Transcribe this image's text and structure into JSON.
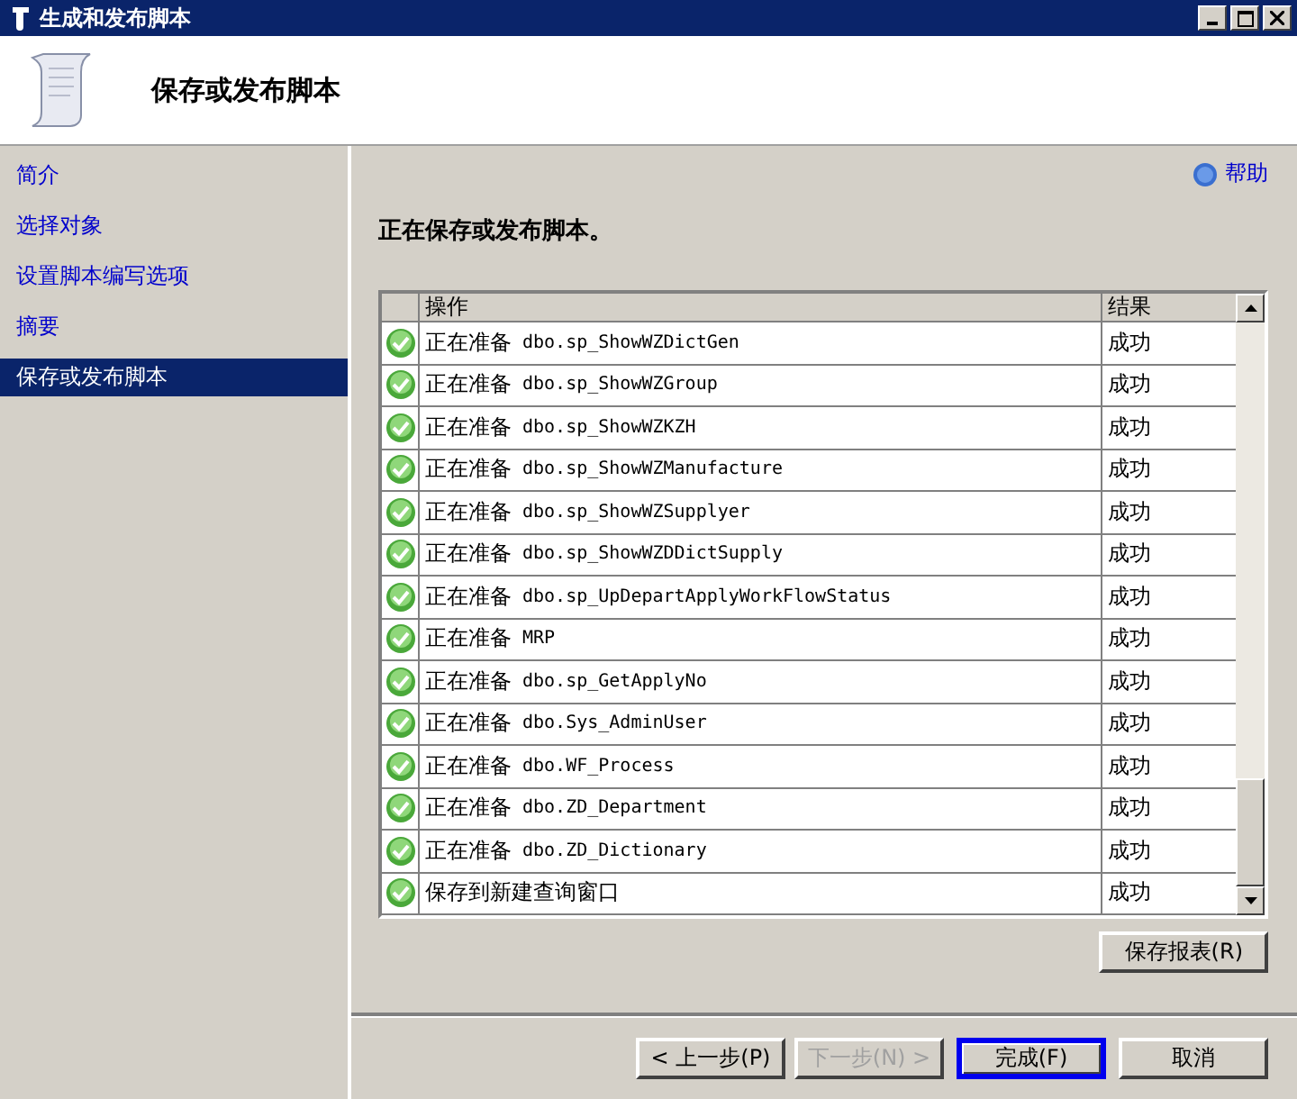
{
  "window": {
    "title": "生成和发布脚本"
  },
  "header": {
    "title": "保存或发布脚本"
  },
  "sidebar": {
    "items": [
      {
        "label": "简介",
        "selected": false
      },
      {
        "label": "选择对象",
        "selected": false
      },
      {
        "label": "设置脚本编写选项",
        "selected": false
      },
      {
        "label": "摘要",
        "selected": false
      },
      {
        "label": "保存或发布脚本",
        "selected": true
      }
    ]
  },
  "help": {
    "label": "帮助"
  },
  "status_text": "正在保存或发布脚本。",
  "table": {
    "columns": [
      "操作",
      "结果"
    ],
    "rows": [
      {
        "action": "正在准备",
        "object": "dbo.sp_ShowWZDictGen",
        "result": "成功"
      },
      {
        "action": "正在准备",
        "object": "dbo.sp_ShowWZGroup",
        "result": "成功"
      },
      {
        "action": "正在准备",
        "object": "dbo.sp_ShowWZKZH",
        "result": "成功"
      },
      {
        "action": "正在准备",
        "object": "dbo.sp_ShowWZManufacture",
        "result": "成功"
      },
      {
        "action": "正在准备",
        "object": "dbo.sp_ShowWZSupplyer",
        "result": "成功"
      },
      {
        "action": "正在准备",
        "object": "dbo.sp_ShowWZDDictSupply",
        "result": "成功"
      },
      {
        "action": "正在准备",
        "object": "dbo.sp_UpDepartApplyWorkFlowStatus",
        "result": "成功"
      },
      {
        "action": "正在准备",
        "object": "MRP",
        "result": "成功"
      },
      {
        "action": "正在准备",
        "object": "dbo.sp_GetApplyNo",
        "result": "成功"
      },
      {
        "action": "正在准备",
        "object": "dbo.Sys_AdminUser",
        "result": "成功"
      },
      {
        "action": "正在准备",
        "object": "dbo.WF_Process",
        "result": "成功"
      },
      {
        "action": "正在准备",
        "object": "dbo.ZD_Department",
        "result": "成功"
      },
      {
        "action": "正在准备",
        "object": "dbo.ZD_Dictionary",
        "result": "成功"
      },
      {
        "action": "保存到新建查询窗口",
        "result": "成功"
      }
    ]
  },
  "save_report_button": "保存报表(R)",
  "buttons": [
    {
      "label": "< 上一步(P)",
      "disabled": false,
      "default": false
    },
    {
      "label": "下一步(N) >",
      "disabled": true,
      "default": false
    },
    {
      "label": "完成(F)",
      "disabled": false,
      "default": true
    },
    {
      "label": "取消",
      "disabled": false,
      "default": false
    }
  ]
}
